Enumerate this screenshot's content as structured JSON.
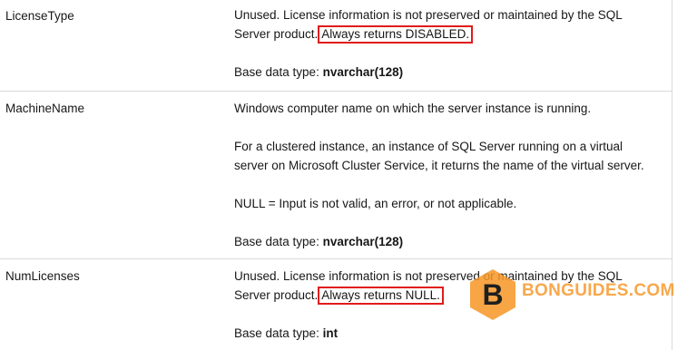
{
  "rows": [
    {
      "property": "LicenseType",
      "desc_line1": "Unused. License information is not preserved or maintained by the SQL",
      "desc_line2_pre": "Server product.",
      "desc_line2_highlight": "Always returns DISABLED.",
      "base_prefix": "Base data type: ",
      "base_type": "nvarchar(128)"
    },
    {
      "property": "MachineName",
      "desc_para1": "Windows computer name on which the server instance is running.",
      "desc_para2_line1": "For a clustered instance, an instance of SQL Server running on a virtual",
      "desc_para2_line2": "server on Microsoft Cluster Service, it returns the name of the virtual server.",
      "desc_para3": "NULL = Input is not valid, an error, or not applicable.",
      "base_prefix": "Base data type: ",
      "base_type": "nvarchar(128)"
    },
    {
      "property": "NumLicenses",
      "desc_line1": "Unused. License information is not preserved or maintained by the SQL",
      "desc_line2_pre": "Server product.",
      "desc_line2_highlight": "Always returns NULL.",
      "base_prefix": "Base data type: ",
      "base_type": "int"
    }
  ],
  "watermark": {
    "letter": "B",
    "text": "BONGUIDES.COM",
    "color": "#f69524"
  },
  "colors": {
    "highlight_border": "#e11b1b",
    "grid_line": "#d9d9d9"
  }
}
